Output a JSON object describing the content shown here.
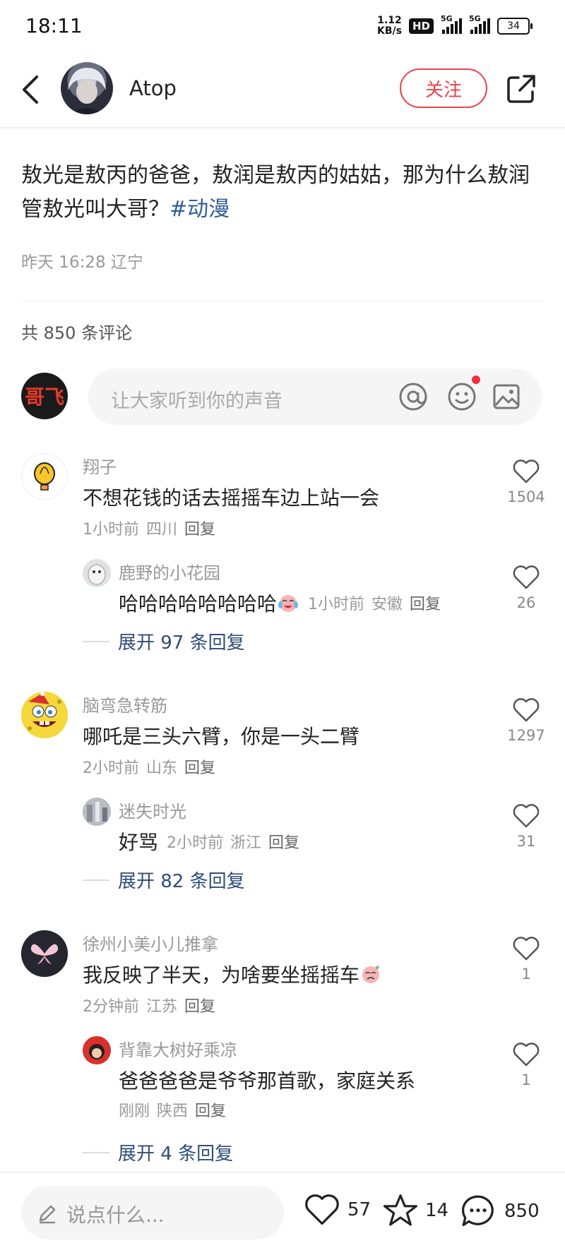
{
  "status_bar": {
    "time": "18:11",
    "net_speed_value": "1.12",
    "net_speed_unit": "KB/s",
    "hd": "HD",
    "sig1": "5G",
    "sig2": "5G",
    "battery": "34"
  },
  "header": {
    "author_name": "Atop",
    "follow_label": "关注"
  },
  "post": {
    "text": "敖光是敖丙的爸爸，敖润是敖丙的姑姑，那为什么敖润管敖光叫大哥？",
    "hashtag": "#动漫",
    "time": "昨天 16:28",
    "location": "辽宁"
  },
  "comments_header": {
    "count_label": "共 850 条评论"
  },
  "composer": {
    "placeholder": "让大家听到你的声音",
    "my_avatar_text": "哥飞"
  },
  "comments": [
    {
      "user": "翔子",
      "text": "不想花钱的话去摇摇车边上站一会",
      "time": "1小时前",
      "location": "四川",
      "reply": "回复",
      "likes": "1504",
      "sub": {
        "user": "鹿野的小花园",
        "text": "哈哈哈哈哈哈哈哈",
        "time": "1小时前",
        "location": "安徽",
        "reply": "回复",
        "likes": "26"
      },
      "expand": "展开 97 条回复"
    },
    {
      "user": "脑弯急转筋",
      "text": "哪吒是三头六臂，你是一头二臂",
      "time": "2小时前",
      "location": "山东",
      "reply": "回复",
      "likes": "1297",
      "sub": {
        "user": "迷失时光",
        "text": "好骂",
        "time": "2小时前",
        "location": "浙江",
        "reply": "回复",
        "likes": "31"
      },
      "expand": "展开 82 条回复"
    },
    {
      "user": "徐州小美小儿推拿",
      "text": "我反映了半天，为啥要坐摇摇车",
      "time": "2分钟前",
      "location": "江苏",
      "reply": "回复",
      "likes": "1",
      "sub": {
        "user": "背靠大树好乘凉",
        "text": "爸爸爸爸是爷爷那首歌，家庭关系",
        "time": "刚刚",
        "location": "陕西",
        "reply": "回复",
        "likes": "1"
      },
      "expand": "展开 4 条回复"
    }
  ],
  "bottom_bar": {
    "placeholder": "说点什么...",
    "likes": "57",
    "stars": "14",
    "comments": "850"
  },
  "colors": {
    "accent": "#e8434e",
    "link": "#2f5d9a",
    "muted": "#999999"
  }
}
